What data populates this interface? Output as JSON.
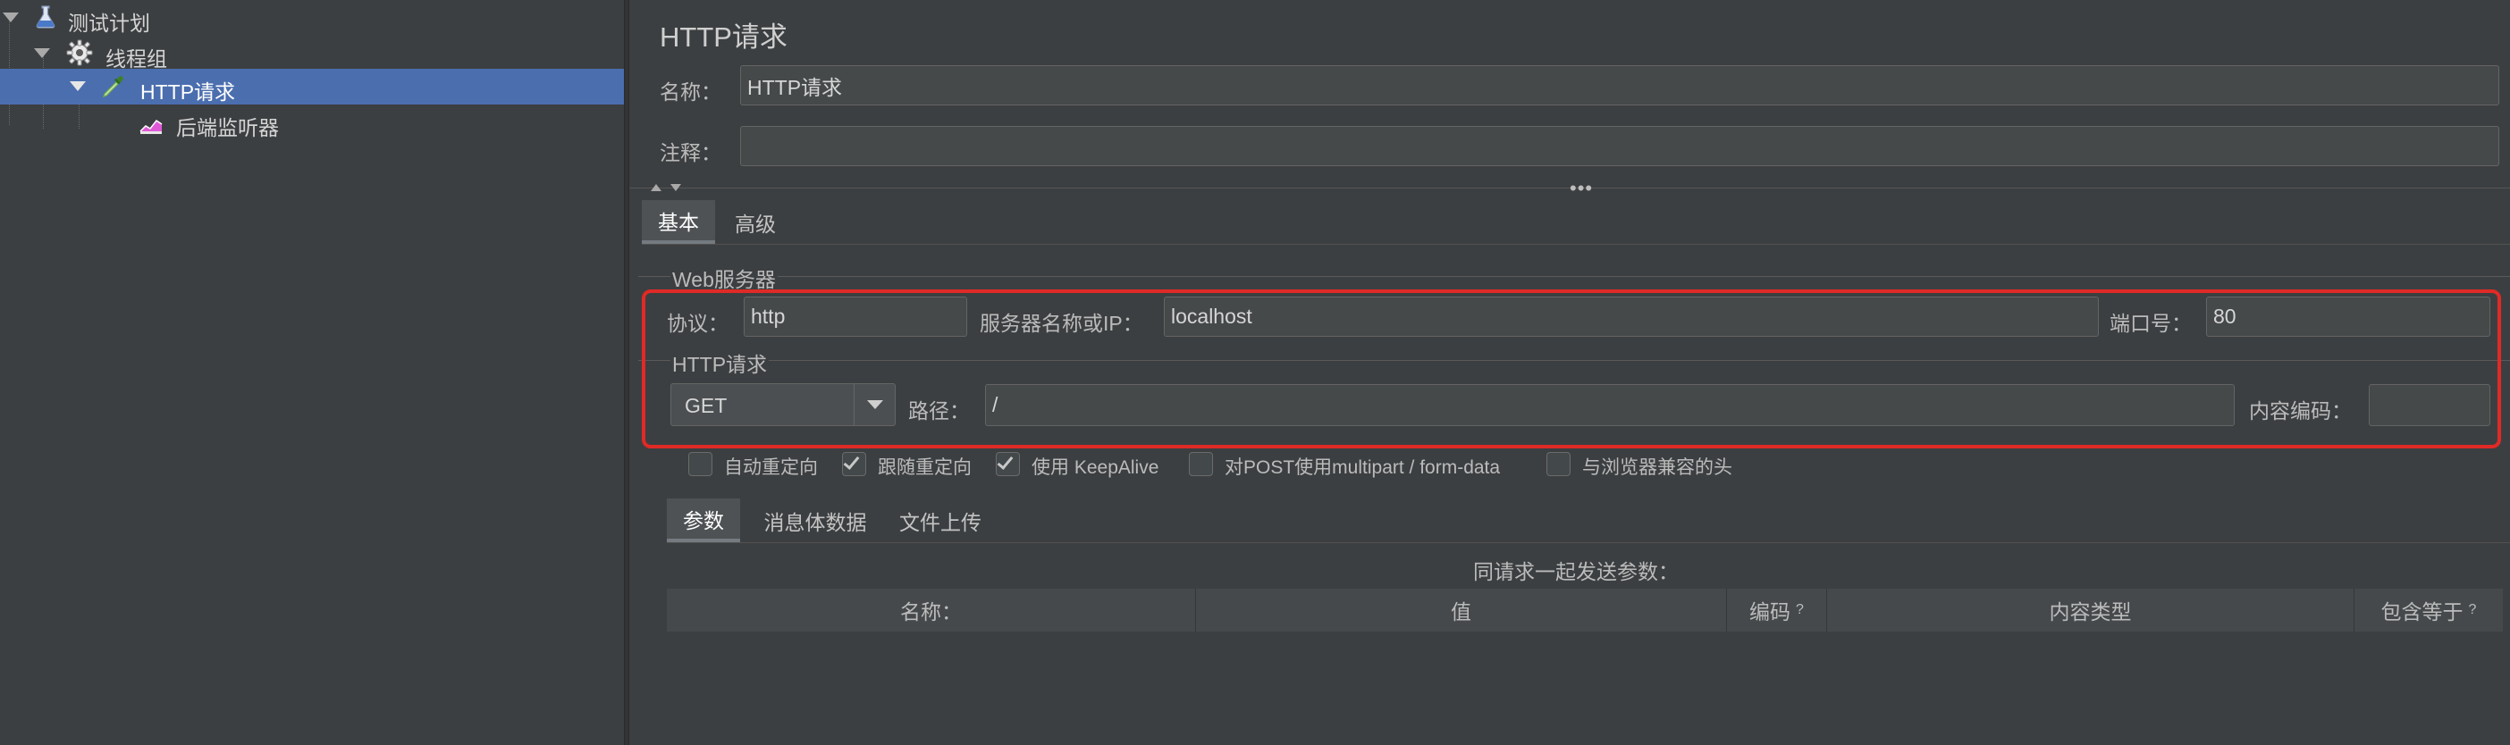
{
  "tree": {
    "items": [
      {
        "label": "测试计划",
        "icon": "flask-icon"
      },
      {
        "label": "线程组",
        "icon": "gear-icon"
      },
      {
        "label": "HTTP请求",
        "icon": "pipette-icon"
      },
      {
        "label": "后端监听器",
        "icon": "chart-icon"
      }
    ]
  },
  "panel": {
    "title": "HTTP请求",
    "name_label": "名称：",
    "name_value": "HTTP请求",
    "comment_label": "注释：",
    "comment_value": ""
  },
  "tabs": [
    "基本",
    "高级"
  ],
  "web_server": {
    "group_title": "Web服务器",
    "protocol_label": "协议：",
    "protocol_value": "http",
    "server_label": "服务器名称或IP：",
    "server_value": "localhost",
    "port_label": "端口号：",
    "port_value": "80"
  },
  "http_request": {
    "group_title": "HTTP请求",
    "method_value": "GET",
    "path_label": "路径：",
    "path_value": "/",
    "encoding_label": "内容编码：",
    "encoding_value": ""
  },
  "options": [
    {
      "label": "自动重定向",
      "checked": false
    },
    {
      "label": "跟随重定向",
      "checked": true
    },
    {
      "label": "使用 KeepAlive",
      "checked": true
    },
    {
      "label": "对POST使用multipart / form-data",
      "checked": false
    },
    {
      "label": "与浏览器兼容的头",
      "checked": false
    }
  ],
  "sub_tabs": [
    "参数",
    "消息体数据",
    "文件上传"
  ],
  "params": {
    "caption": "同请求一起发送参数：",
    "columns": [
      {
        "label": "名称：",
        "hint": ""
      },
      {
        "label": "值",
        "hint": ""
      },
      {
        "label": "编码",
        "hint": "?"
      },
      {
        "label": "内容类型",
        "hint": ""
      },
      {
        "label": "包含等于",
        "hint": "?"
      }
    ]
  },
  "colors": {
    "background": "#3c3f41",
    "selection": "#4b6eaf",
    "highlight_border": "#e02a26"
  }
}
